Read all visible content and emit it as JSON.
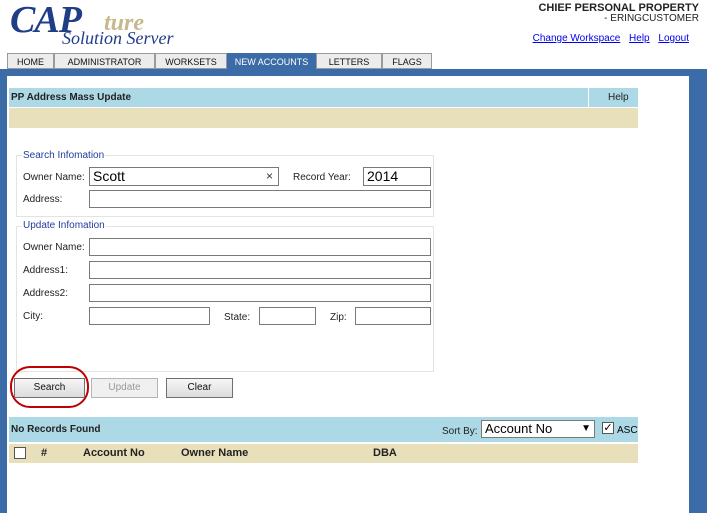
{
  "header": {
    "logo_cap": "CAP",
    "logo_ture": "ture",
    "logo_sub": "Solution Server",
    "title": "CHIEF  PERSONAL PROPERTY",
    "user": "- ERINGCUSTOMER",
    "links": [
      "Change Workspace",
      "Help",
      "Logout"
    ]
  },
  "tabs": [
    "HOME",
    "ADMINISTRATOR",
    "WORKSETS",
    "NEW ACCOUNTS",
    "LETTERS",
    "FLAGS"
  ],
  "active_tab": "NEW ACCOUNTS",
  "panel": {
    "title": "PP Address Mass Update",
    "help": "Help"
  },
  "search": {
    "title": "Search Infomation",
    "owner_label": "Owner Name:",
    "owner_value": "Scott",
    "clear_icon": "×",
    "year_label": "Record Year:",
    "year_value": "2014",
    "address_label": "Address:"
  },
  "update": {
    "title": "Update Infomation",
    "owner_label": "Owner Name:",
    "address1_label": "Address1:",
    "address2_label": "Address2:",
    "city_label": "City:",
    "state_label": "State:",
    "zip_label": "Zip:"
  },
  "buttons": {
    "search": "Search",
    "update": "Update",
    "clear": "Clear"
  },
  "results": {
    "status": "No Records Found",
    "sort_label": "Sort By:",
    "sort_value": "Account No",
    "asc_label": "ASC",
    "asc_checked": "✓",
    "columns": [
      "#",
      "Account No",
      "Owner Name",
      "DBA"
    ]
  },
  "colors": {
    "brand_blue": "#3c6ca8",
    "header_light_blue": "#add8e6",
    "tan": "#e8dfbb",
    "highlight_red": "#c00000"
  }
}
